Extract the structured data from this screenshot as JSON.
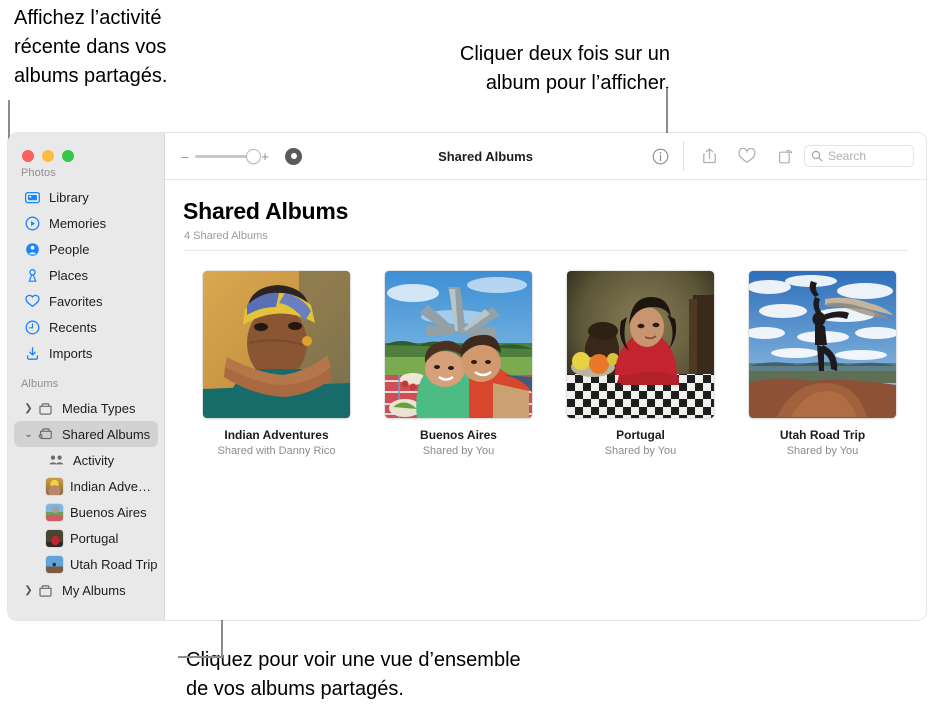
{
  "annotations": {
    "left": "Affichez l’activité\nrécente dans vos\nalbums partagés.",
    "top": "Cliquer deux fois sur un\nalbum pour l’afficher.",
    "bottom": "Cliquez pour voir une vue d’ensemble\nde vos albums partagés."
  },
  "window": {
    "traffic_lights": [
      "close",
      "minimize",
      "zoom"
    ]
  },
  "toolbar": {
    "zoom_minus": "–",
    "zoom_plus": "+",
    "title": "Shared Albums",
    "info_icon": "info-icon",
    "share_icon": "share-icon",
    "favorite_icon": "heart-icon",
    "rotate_icon": "rotate-icon",
    "search_placeholder": "Search",
    "search_value": ""
  },
  "sidebar": {
    "sections": [
      {
        "header": "Photos",
        "items": [
          {
            "label": "Library",
            "icon": "library-icon"
          },
          {
            "label": "Memories",
            "icon": "memories-icon"
          },
          {
            "label": "People",
            "icon": "people-icon"
          },
          {
            "label": "Places",
            "icon": "places-icon"
          },
          {
            "label": "Favorites",
            "icon": "heart-icon"
          },
          {
            "label": "Recents",
            "icon": "clock-icon"
          },
          {
            "label": "Imports",
            "icon": "import-icon"
          }
        ]
      },
      {
        "header": "Albums",
        "items": [
          {
            "label": "Media Types",
            "icon": "album-icon",
            "twisty": "collapsed"
          },
          {
            "label": "Shared Albums",
            "icon": "shared-album-icon",
            "twisty": "expanded",
            "selected": true
          },
          {
            "label": "Activity",
            "icon": "activity-icon",
            "child": true
          },
          {
            "label": "Indian Advent…",
            "icon": "thumb-indian",
            "child": true
          },
          {
            "label": "Buenos Aires",
            "icon": "thumb-buenos",
            "child": true
          },
          {
            "label": "Portugal",
            "icon": "thumb-portugal",
            "child": true
          },
          {
            "label": "Utah Road Trip",
            "icon": "thumb-utah",
            "child": true
          },
          {
            "label": "My Albums",
            "icon": "album-icon",
            "twisty": "collapsed"
          }
        ]
      }
    ]
  },
  "main": {
    "title": "Shared Albums",
    "subtitle": "4 Shared Albums",
    "albums": [
      {
        "title": "Indian Adventures",
        "subtitle": "Shared with Danny Rico",
        "thumb": "woman-headwrap"
      },
      {
        "title": "Buenos Aires",
        "subtitle": "Shared by You",
        "thumb": "boys-picnic"
      },
      {
        "title": "Portugal",
        "subtitle": "Shared by You",
        "thumb": "woman-table"
      },
      {
        "title": "Utah Road Trip",
        "subtitle": "Shared by You",
        "thumb": "desert-dancer"
      }
    ]
  },
  "colors": {
    "accent": "#007aff",
    "sidebar_bg": "#e9e9e9",
    "selected_row": "#d3d2d2",
    "leader_line": "#8c8c8c"
  }
}
